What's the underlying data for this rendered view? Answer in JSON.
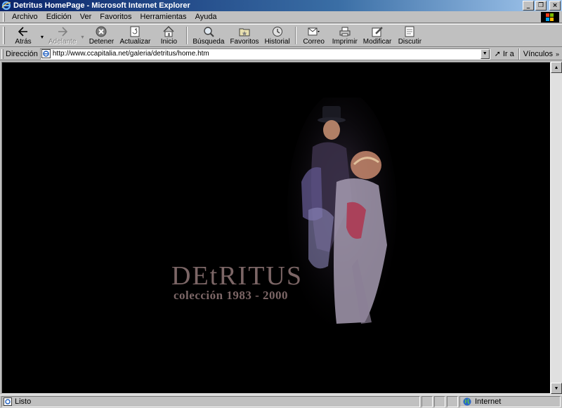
{
  "window": {
    "title": "Detritus HomePage - Microsoft Internet Explorer",
    "controls": {
      "minimize": "_",
      "maximize": "❐",
      "close": "×"
    }
  },
  "menu": {
    "items": [
      {
        "label": "Archivo"
      },
      {
        "label": "Edición"
      },
      {
        "label": "Ver"
      },
      {
        "label": "Favoritos"
      },
      {
        "label": "Herramientas"
      },
      {
        "label": "Ayuda"
      }
    ]
  },
  "toolbar": {
    "back": "Atrás",
    "forward": "Adelante",
    "stop": "Detener",
    "refresh": "Actualizar",
    "home": "Inicio",
    "search": "Búsqueda",
    "favorites": "Favoritos",
    "history": "Historial",
    "mail": "Correo",
    "print": "Imprimir",
    "edit": "Modificar",
    "discuss": "Discutir"
  },
  "address": {
    "label": "Dirección",
    "url": "http://www.ccapitalia.net/galeria/detritus/home.htm",
    "go": "Ir a",
    "links": "Vínculos"
  },
  "page": {
    "title": "DEtRITUS",
    "subtitle": "colección 1983 - 2000"
  },
  "status": {
    "text": "Listo",
    "zone": "Internet"
  },
  "colors": {
    "titlebar_start": "#0a246a",
    "titlebar_end": "#a6caf0",
    "chrome": "#c0c0c0",
    "page_bg": "#000000",
    "title_text": "#7c6666"
  }
}
